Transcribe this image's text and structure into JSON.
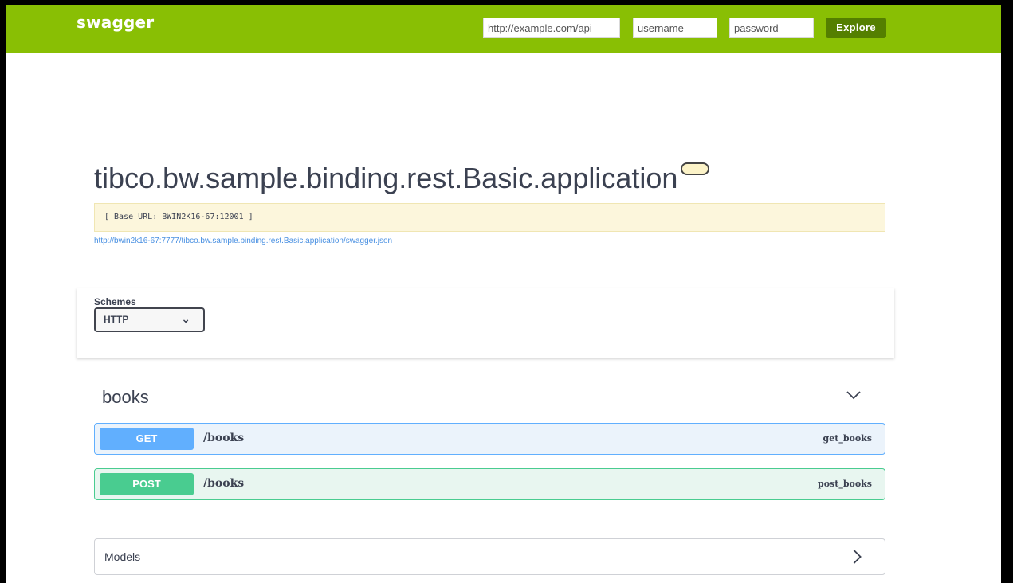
{
  "topbar": {
    "brand": "swagger",
    "url_placeholder": "http://example.com/api",
    "username_placeholder": "username",
    "password_placeholder": "password",
    "explore_label": "Explore",
    "background_color": "#89bf04",
    "explore_color": "#547f00"
  },
  "info": {
    "title": "tibco.bw.sample.binding.rest.Basic.application",
    "base_url": "[ Base URL: BWIN2K16-67:12001 ]",
    "spec_link": "http://bwin2k16-67:7777/tibco.bw.sample.binding.rest.Basic.application/swagger.json"
  },
  "schemes": {
    "label": "Schemes",
    "selected": "HTTP",
    "chevron_icon": "chevron-down-icon"
  },
  "tag": {
    "name": "books",
    "chevron_icon": "chevron-down-icon",
    "operations": [
      {
        "method": "GET",
        "path": "/books",
        "operation_id": "get_books",
        "color": "#61affe"
      },
      {
        "method": "POST",
        "path": "/books",
        "operation_id": "post_books",
        "color": "#49cc90"
      }
    ]
  },
  "models": {
    "label": "Models",
    "chevron_icon": "chevron-right-icon"
  }
}
